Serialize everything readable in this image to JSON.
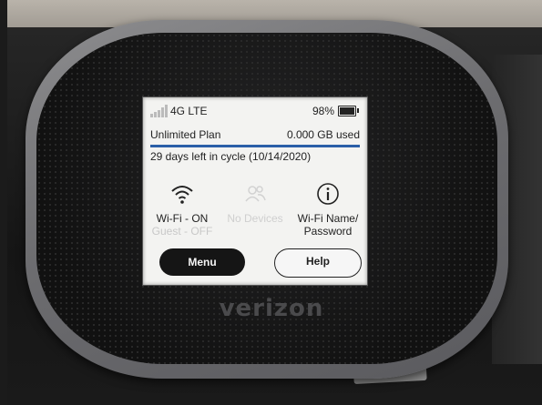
{
  "status_bar": {
    "network": "4G LTE",
    "battery_text": "98%",
    "battery_level": 0.98,
    "signal_bars": 5,
    "signal_active": 0
  },
  "plan": {
    "name": "Unlimited Plan",
    "usage": "0.000 GB used",
    "cycle": "29 days left in cycle (10/14/2020)"
  },
  "tiles": [
    {
      "icon": "wifi-icon",
      "label": "Wi-Fi - ON",
      "sub": "Guest - OFF"
    },
    {
      "icon": "devices-icon",
      "label": "No Devices",
      "sub": ""
    },
    {
      "icon": "info-icon",
      "label": "Wi-Fi Name/",
      "sub": "Password"
    }
  ],
  "buttons": {
    "menu": "Menu",
    "help": "Help"
  },
  "brand": {
    "logo_text": "verizon"
  },
  "colors": {
    "usage_bar": "#2b5fa8",
    "menu_button": "#151515"
  }
}
